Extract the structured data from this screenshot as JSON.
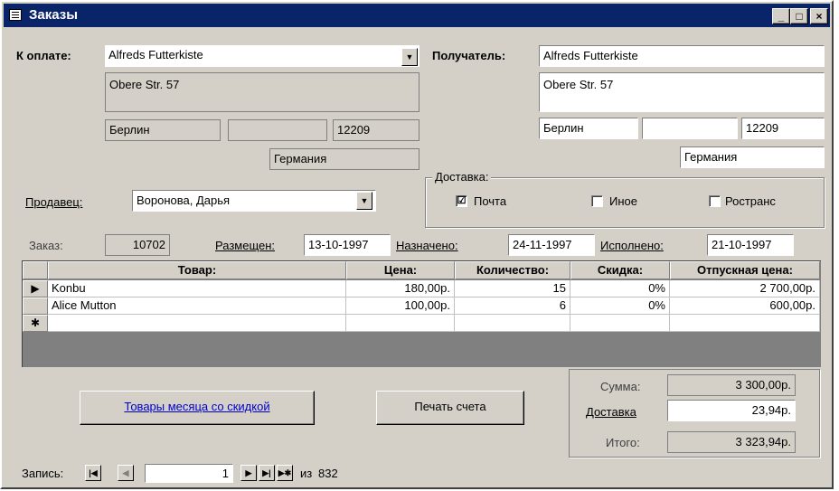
{
  "window": {
    "title": "Заказы",
    "controls": {
      "minimize": "_",
      "maximize": "□",
      "close": "×"
    }
  },
  "billing": {
    "label": "К оплате:",
    "customer": "Alfreds Futterkiste",
    "address": "Obere Str. 57",
    "city": "Берлин",
    "region": "",
    "postal": "12209",
    "country": "Германия"
  },
  "recipient": {
    "label": "Получатель:",
    "name": "Alfreds Futterkiste",
    "address": "Obere Str. 57",
    "city": "Берлин",
    "region": "",
    "postal": "12209",
    "country": "Германия"
  },
  "seller": {
    "label": "Продавец:",
    "value": "Воронова, Дарья"
  },
  "delivery": {
    "label": "Доставка:",
    "options": [
      {
        "label": "Почта",
        "checked": "☑"
      },
      {
        "label": "Иное",
        "checked": ""
      },
      {
        "label": "Ространс",
        "checked": ""
      }
    ]
  },
  "order": {
    "order_label": "Заказ:",
    "order_id": "10702",
    "placed_label": "Размещен:",
    "placed": "13-10-1997",
    "due_label": "Назначено:",
    "due": "24-11-1997",
    "done_label": "Исполнено:",
    "done": "21-10-1997"
  },
  "grid": {
    "headers": [
      "Товар:",
      "Цена:",
      "Количество:",
      "Скидка:",
      "Отпускная цена:"
    ],
    "rows": [
      {
        "selector": "▶",
        "product": "Konbu",
        "price": "180,00р.",
        "qty": "15",
        "discount": "0%",
        "total": "2 700,00р."
      },
      {
        "selector": "",
        "product": "Alice Mutton",
        "price": "100,00р.",
        "qty": "6",
        "discount": "0%",
        "total": "600,00р."
      }
    ],
    "new_row_marker": "✱"
  },
  "buttons": {
    "discount_products": "Товары месяца со скидкой",
    "print_invoice": "Печать счета"
  },
  "totals": {
    "sum_label": "Сумма:",
    "sum": "3 300,00р.",
    "delivery_label": "Доставка",
    "delivery": "23,94р.",
    "total_label": "Итого:",
    "total": "3 323,94р."
  },
  "navigator": {
    "label": "Запись:",
    "first": "|◀",
    "prev": "◀",
    "current": "1",
    "next": "▶",
    "last": "▶|",
    "new": "▶✱",
    "of_label": "из",
    "count": "832"
  }
}
